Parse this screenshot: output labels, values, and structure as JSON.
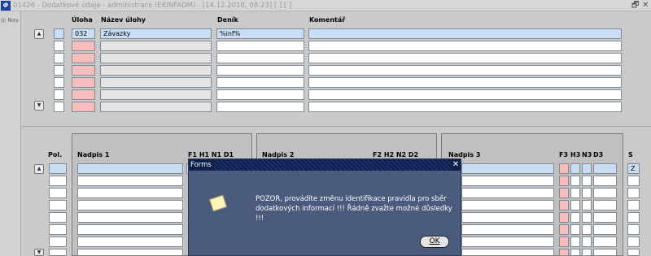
{
  "window": {
    "app_icon": "Ф",
    "title": "01426 - Dodatkové údaje - administrace (EKINFADM) - [14.12.2018; 08:23] [ ] [ ]",
    "restore_icon": "restore-icon",
    "restore_glyph": "🗗",
    "close_glyph": "✕"
  },
  "nav": {
    "label": "Nav",
    "icon": "◎"
  },
  "upper_table": {
    "headers": {
      "uloha": "Úloha",
      "nazev": "Název úlohy",
      "denik": "Deník",
      "komentar": "Komentář"
    },
    "rows": [
      {
        "uloha": "032",
        "nazev": "Závazky",
        "denik": "%inf%",
        "komentar": ""
      },
      {
        "uloha": "",
        "nazev": "",
        "denik": "",
        "komentar": ""
      },
      {
        "uloha": "",
        "nazev": "",
        "denik": "",
        "komentar": ""
      },
      {
        "uloha": "",
        "nazev": "",
        "denik": "",
        "komentar": ""
      },
      {
        "uloha": "",
        "nazev": "",
        "denik": "",
        "komentar": ""
      },
      {
        "uloha": "",
        "nazev": "",
        "denik": "",
        "komentar": ""
      },
      {
        "uloha": "",
        "nazev": "",
        "denik": "",
        "komentar": ""
      }
    ],
    "scroll_up": "▲",
    "scroll_down": "▼"
  },
  "lower_table": {
    "pol": "Pol.",
    "nadpis1": "Nadpis 1",
    "flags1": "F1 H1 N1 D1",
    "nadpis2": "Nadpis 2",
    "flags2": "F2 H2 N2 D2",
    "nadpis3": "Nadpis 3",
    "flags3": {
      "f3": "F3",
      "h3": "H3",
      "n3": "N3",
      "d3": "D3"
    },
    "s": "S",
    "s_value": "Z",
    "scroll_up": "▲",
    "scroll_down": "▼"
  },
  "dialog": {
    "title": "Forms",
    "close": "✕",
    "message": "POZOR, provádíte změnu identifikace pravidla pro sběr dodatkových informací !!! Řádně zvažte možné důsledky !!!",
    "ok_label": "OK",
    "colors": {
      "body": "#4a5b7d",
      "titlebar": "#0f1f4a"
    }
  }
}
